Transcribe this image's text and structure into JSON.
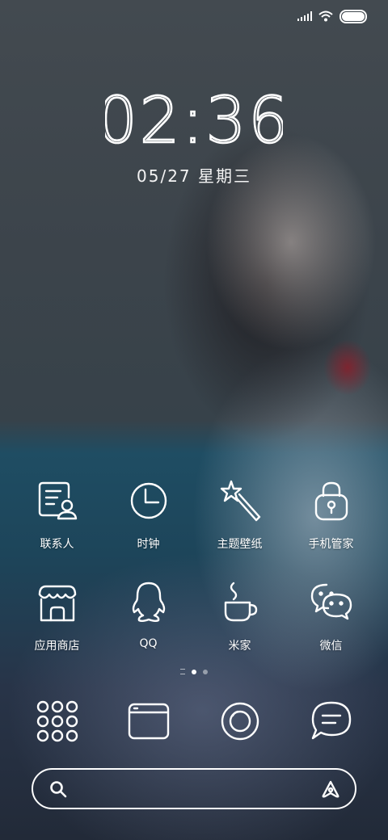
{
  "status_bar": {
    "signal_icon": "signal-bars-icon",
    "wifi_icon": "wifi-icon",
    "battery_icon": "battery-icon",
    "battery_level": 1.0
  },
  "lock_clock": {
    "time": "02:36",
    "date": "05/27 星期三"
  },
  "apps": [
    [
      {
        "label": "联系人",
        "icon": "contacts-icon"
      },
      {
        "label": "时钟",
        "icon": "clock-icon"
      },
      {
        "label": "主题壁纸",
        "icon": "magic-wand-icon"
      },
      {
        "label": "手机管家",
        "icon": "security-lock-icon"
      }
    ],
    [
      {
        "label": "应用商店",
        "icon": "store-icon"
      },
      {
        "label": "QQ",
        "icon": "qq-penguin-icon"
      },
      {
        "label": "米家",
        "icon": "coffee-cup-icon"
      },
      {
        "label": "微信",
        "icon": "wechat-icon"
      }
    ]
  ],
  "page_indicator": {
    "pages": 2,
    "current": 1
  },
  "dock": [
    {
      "icon": "app-drawer-icon"
    },
    {
      "icon": "browser-icon"
    },
    {
      "icon": "camera-icon"
    },
    {
      "icon": "message-icon"
    }
  ],
  "search": {
    "placeholder": "",
    "value": "",
    "search_icon": "search-icon",
    "assistant_icon": "assistant-icon"
  }
}
